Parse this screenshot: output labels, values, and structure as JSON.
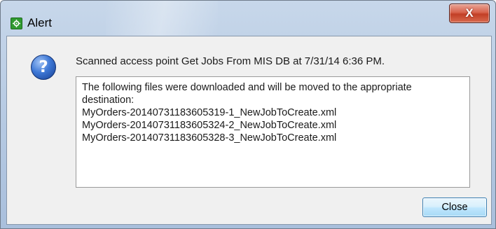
{
  "window": {
    "title": "Alert",
    "close_glyph": "X"
  },
  "icons": {
    "app": "app-gear-icon",
    "help": "question-icon",
    "close": "close-icon"
  },
  "dialog": {
    "help_glyph": "?",
    "message": "Scanned access point Get Jobs From MIS DB at 7/31/14 6:36 PM.",
    "details": [
      "The following files were downloaded and will be moved to the appropriate destination:",
      "MyOrders-20140731183605319-1_NewJobToCreate.xml",
      "MyOrders-20140731183605324-2_NewJobToCreate.xml",
      "MyOrders-20140731183605328-3_NewJobToCreate.xml"
    ],
    "close_label": "Close"
  },
  "colors": {
    "title_bar": "#b5c9e2",
    "close_x": "#c23f26",
    "app_icon": "#2f9a2f",
    "help_icon": "#3e78d6",
    "button_border": "#3c7fb1"
  }
}
